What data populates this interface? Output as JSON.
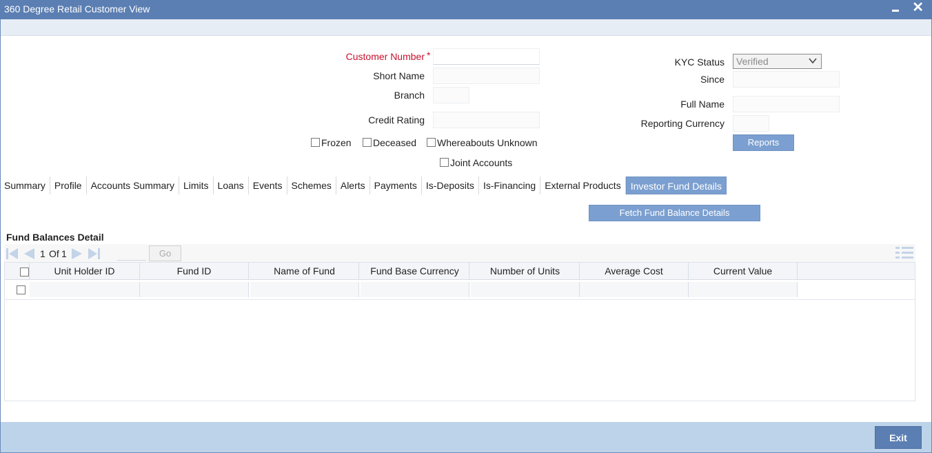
{
  "window": {
    "title": "360 Degree Retail Customer View"
  },
  "customer": {
    "customer_number_label": "Customer Number",
    "required_mark": "*",
    "short_name_label": "Short Name",
    "branch_label": "Branch",
    "credit_rating_label": "Credit Rating",
    "frozen_label": "Frozen",
    "deceased_label": "Deceased",
    "whereabouts_label": "Whereabouts Unknown",
    "joint_accounts_label": "Joint Accounts",
    "kyc_status_label": "KYC Status",
    "kyc_status_value": "Verified",
    "since_label": "Since",
    "full_name_label": "Full Name",
    "reporting_currency_label": "Reporting Currency",
    "reports_button": "Reports"
  },
  "tabs": [
    {
      "label": "Summary"
    },
    {
      "label": "Profile"
    },
    {
      "label": "Accounts Summary"
    },
    {
      "label": "Limits"
    },
    {
      "label": "Loans"
    },
    {
      "label": "Events"
    },
    {
      "label": "Schemes"
    },
    {
      "label": "Alerts"
    },
    {
      "label": "Payments"
    },
    {
      "label": "Is-Deposits"
    },
    {
      "label": "Is-Financing"
    },
    {
      "label": "External Products"
    },
    {
      "label": "Investor Fund Details",
      "active": true
    }
  ],
  "fund": {
    "fetch_button": "Fetch Fund Balance Details",
    "section_title": "Fund Balances Detail",
    "pager": {
      "current": "1",
      "of_label": "Of",
      "total": "1",
      "go_label": "Go"
    },
    "columns": [
      "Unit Holder ID",
      "Fund ID",
      "Name of Fund",
      "Fund Base Currency",
      "Number of Units",
      "Average Cost",
      "Current Value"
    ]
  },
  "footer": {
    "exit_label": "Exit"
  },
  "icons": {
    "title_minimize": "minimize-icon",
    "title_close": "close-icon",
    "pager": [
      "first-page-icon",
      "previous-page-icon",
      "next-page-icon",
      "last-page-icon"
    ],
    "grid": "column-settings-icon"
  },
  "colors": {
    "titlebar": "#5b7fb3",
    "accent": "#7b9fd0",
    "required": "#c8102e",
    "footer": "#bdd3ea"
  }
}
